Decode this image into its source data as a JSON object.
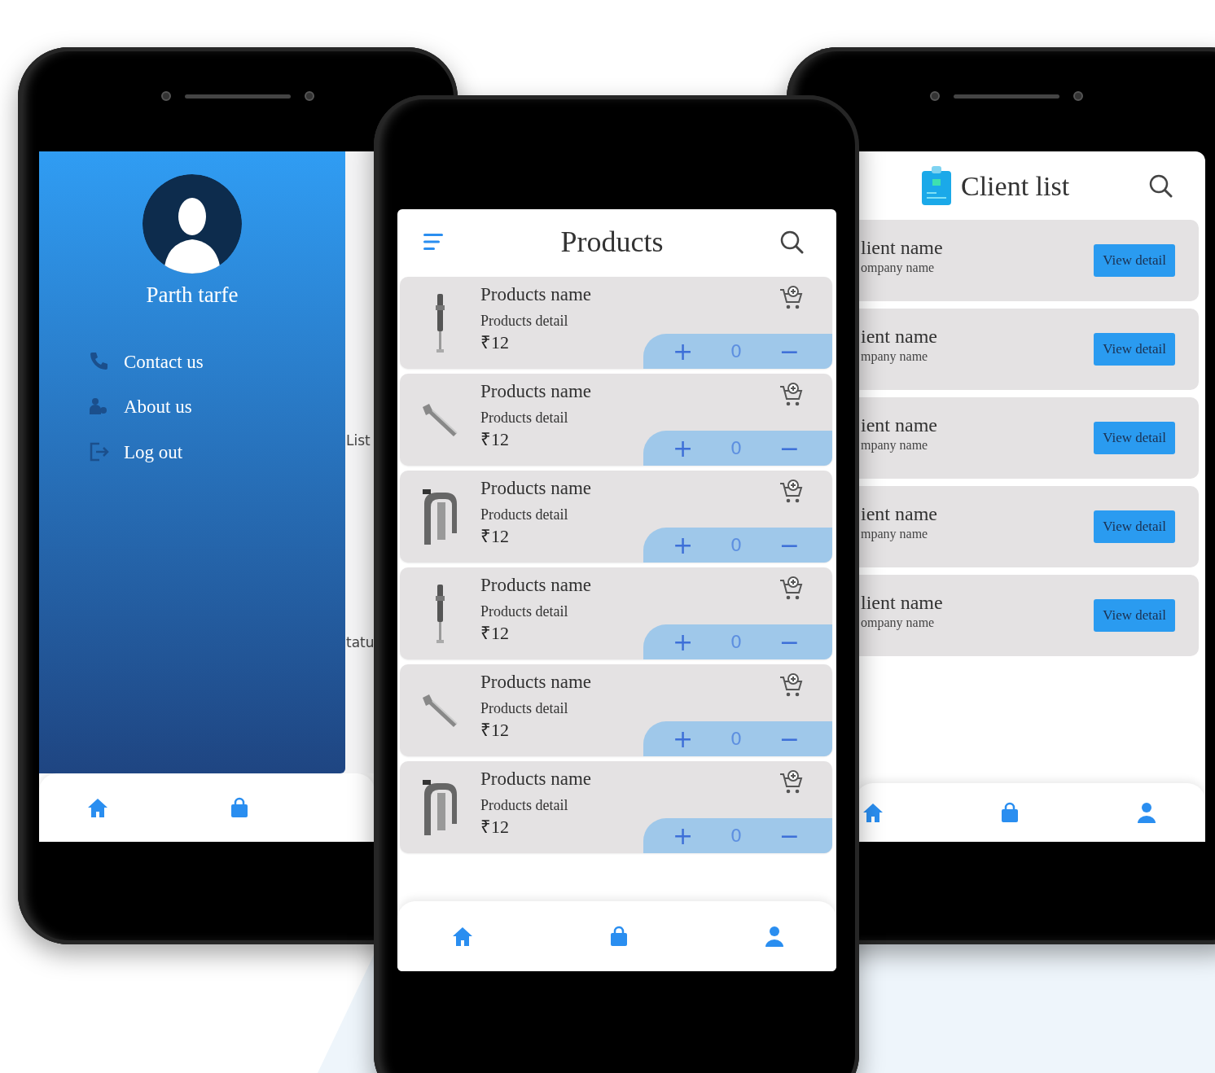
{
  "drawer_phone": {
    "tiles": [
      {
        "label": "List"
      },
      {
        "label": "tatu"
      }
    ],
    "user_name": "Parth tarfe",
    "menu": [
      {
        "label": "Contact us"
      },
      {
        "label": "About us"
      },
      {
        "label": "Log out"
      }
    ]
  },
  "products_phone": {
    "title": "Products",
    "products": [
      {
        "name": "Products name",
        "detail": "Products detail",
        "price": "₹12",
        "add": "+",
        "quantity": "0",
        "remove": "−"
      },
      {
        "name": "Products name",
        "detail": "Products detail",
        "price": "₹12",
        "add": "+",
        "quantity": "0",
        "remove": "−"
      },
      {
        "name": "Products name",
        "detail": "Products detail",
        "price": "₹12",
        "add": "+",
        "quantity": "0",
        "remove": "−"
      },
      {
        "name": "Products name",
        "detail": "Products detail",
        "price": "₹12",
        "add": "+",
        "quantity": "0",
        "remove": "−"
      },
      {
        "name": "Products name",
        "detail": "Products detail",
        "price": "₹12",
        "add": "+",
        "quantity": "0",
        "remove": "−"
      },
      {
        "name": "Products name",
        "detail": "Products detail",
        "price": "₹12",
        "add": "+",
        "quantity": "0",
        "remove": "−"
      }
    ]
  },
  "clients_phone": {
    "title": "Client list",
    "clients": [
      {
        "name": "lient name",
        "company": "ompany name",
        "button": "View detail"
      },
      {
        "name": "ient name",
        "company": "mpany name",
        "button": "View detail"
      },
      {
        "name": "ient name",
        "company": "mpany name",
        "button": "View detail"
      },
      {
        "name": "ient name",
        "company": "mpany name",
        "button": "View detail"
      },
      {
        "name": "lient name",
        "company": "ompany name",
        "button": "View detail"
      }
    ]
  }
}
